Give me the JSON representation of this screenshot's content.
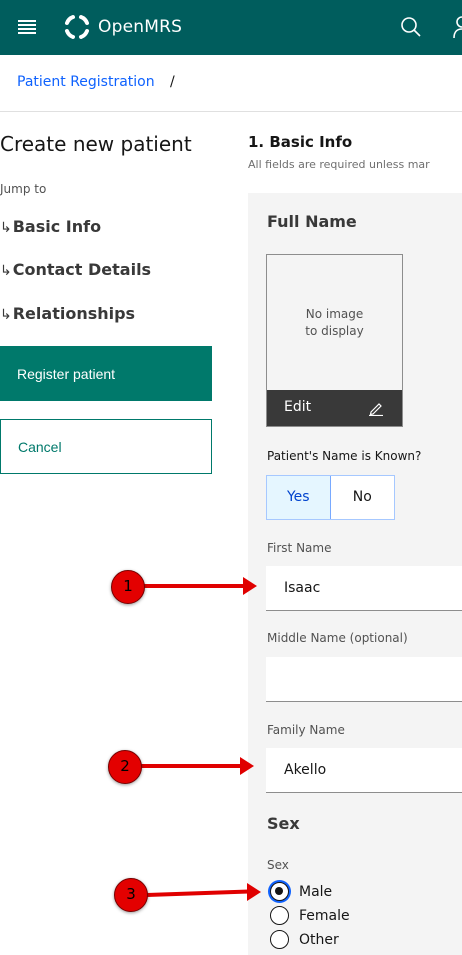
{
  "header": {
    "app_name": "OpenMRS",
    "menu_icon": "hamburger-menu-icon",
    "search_icon": "search-icon",
    "user_icon": "user-icon",
    "background": "#005d5d"
  },
  "breadcrumb": {
    "link": "Patient Registration",
    "separator": "/"
  },
  "sidebar": {
    "title": "Create new patient",
    "jump_to": "Jump to",
    "links": [
      {
        "arrow": "↳",
        "label": "Basic Info"
      },
      {
        "arrow": "↳",
        "label": "Contact Details"
      },
      {
        "arrow": "↳",
        "label": "Relationships"
      }
    ],
    "register_label": "Register patient",
    "cancel_label": "Cancel"
  },
  "form": {
    "section_title": "1. Basic Info",
    "section_subtitle": "All fields are required unless mar",
    "full_name_heading": "Full Name",
    "photo": {
      "placeholder_line1": "No image",
      "placeholder_line2": "to display",
      "edit_label": "Edit"
    },
    "name_known_label": "Patient's Name is Known?",
    "name_known_options": {
      "yes": "Yes",
      "no": "No",
      "selected": "Yes"
    },
    "first_name_label": "First Name",
    "first_name_value": "Isaac",
    "middle_name_label": "Middle Name (optional)",
    "middle_name_value": "",
    "family_name_label": "Family Name",
    "family_name_value": "Akello",
    "sex_heading": "Sex",
    "sex_label": "Sex",
    "sex_options": [
      {
        "label": "Male",
        "checked": true
      },
      {
        "label": "Female",
        "checked": false
      },
      {
        "label": "Other",
        "checked": false
      }
    ]
  },
  "annotations": [
    {
      "number": "1",
      "target": "first-name-input"
    },
    {
      "number": "2",
      "target": "family-name-input"
    },
    {
      "number": "3",
      "target": "sex-radio-male"
    }
  ],
  "colors": {
    "accent": "#00796b",
    "link": "#0f62fe",
    "annotation": "#e00000"
  }
}
